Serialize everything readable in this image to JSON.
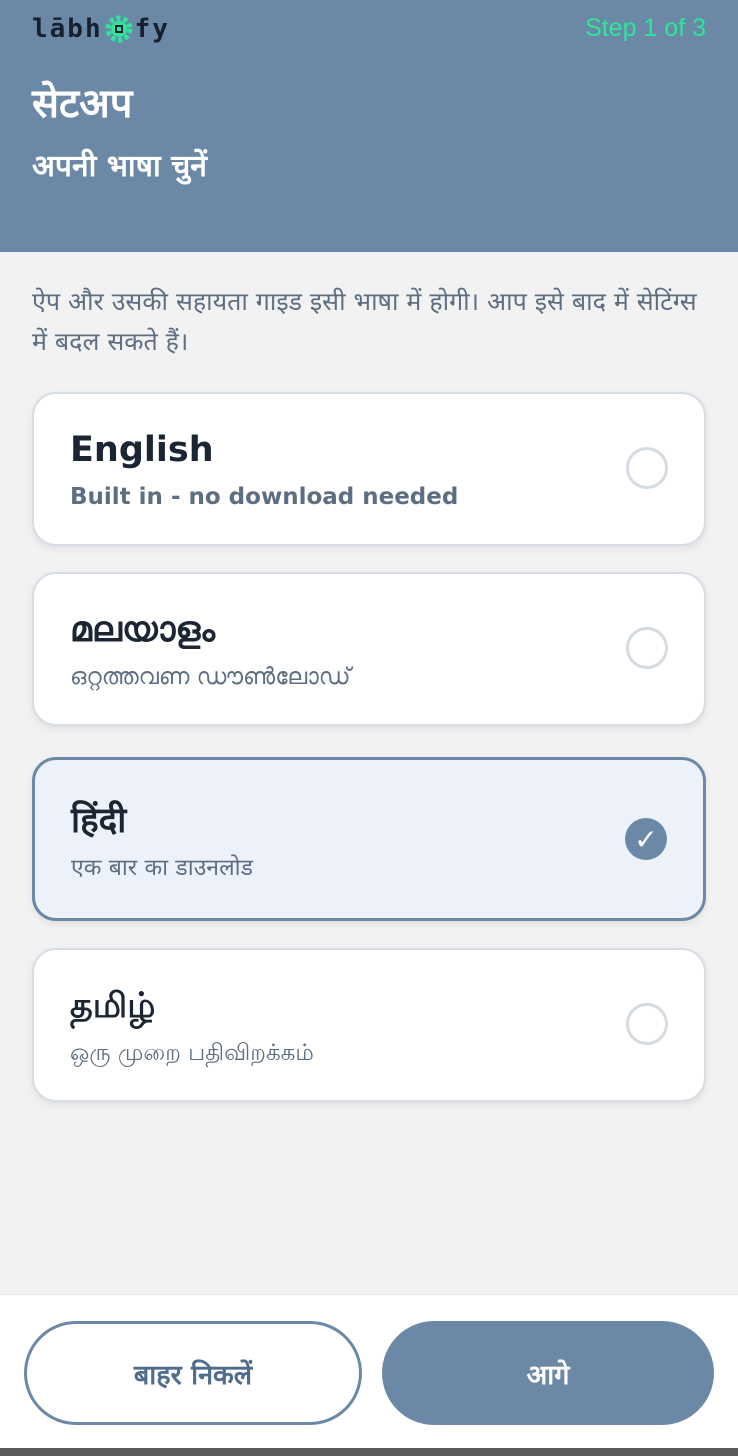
{
  "header": {
    "logo_left": "lābh",
    "logo_right": "fy",
    "step": "Step 1 of 3",
    "title": "सेटअप",
    "subtitle": "अपनी भाषा चुनें"
  },
  "description": "ऐप और उसकी सहायता गाइड इसी भाषा में होगी। आप इसे बाद में सेटिंग्स में बदल सकते हैं।",
  "languages": [
    {
      "name": "English",
      "sub": "Built in - no download needed",
      "selected": false
    },
    {
      "name": "മലയാളം",
      "sub": "ഒറ്റത്തവണ ഡൗൺലോഡ്",
      "selected": false
    },
    {
      "name": "हिंदी",
      "sub": "एक बार का डाउनलोड",
      "selected": true
    },
    {
      "name": "தமிழ்",
      "sub": "ஒரு முறை பதிவிறக்கம்",
      "selected": false
    }
  ],
  "check_glyph": "✓",
  "footer": {
    "exit_label": "बाहर निकलें",
    "next_label": "आगे"
  },
  "colors": {
    "accent": "#6b89a6",
    "step": "#2ee59a",
    "logo_gear": "#2ee59a"
  },
  "icons": {
    "logo": "gear-chip-icon",
    "selected": "check-icon"
  }
}
